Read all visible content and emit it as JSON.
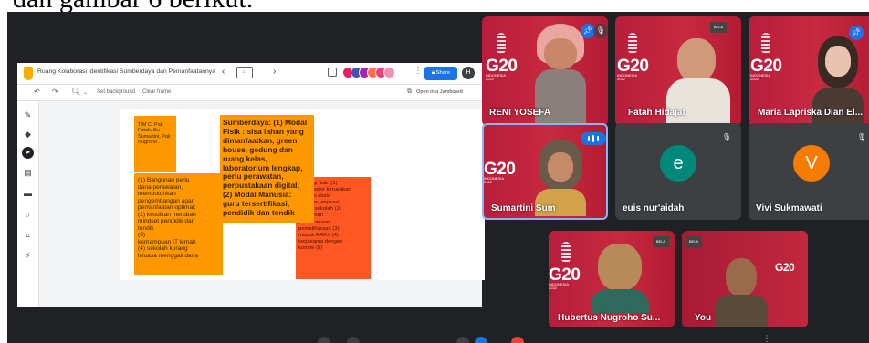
{
  "page_text": "dan gambar 6 berikut.",
  "jamboard": {
    "title": "Ruang Kolaborasi Identifikasi Sumberdaya dan Pemanfaatannya",
    "prev_icon": "chevron-left-icon",
    "next_icon": "chevron-right-icon",
    "share_label": "Share",
    "user_initial": "H",
    "toolbar": {
      "set_background": "Set background",
      "clear_frame": "Clear frame",
      "open_in_jamboard": "Open in a Jamboard"
    },
    "notes": [
      {
        "text": "TIM C: Pak\nFatah, Bu\nSumartini, Pak\nNugroho .",
        "color": "#ff9800"
      },
      {
        "text": "Sumberdaya: (1) Modal\nFisik : sisa lahan yang\ndimanfaatkan, green\nhouse, gedung dan\nruang kelas,\nlaboratorium lengkap,\nperlu perawatan,\nperpustakaan digital;\n(2) Modal Manusia:\nguru tersertifikasi,\npendidik dan tendik",
        "color": "#ff9800"
      },
      {
        "text": "(1) Bangunan perlu\ndana perawatan,\nmembutuhkan\npengembangan agar\npemanfaatan optimal;\n(2) kesulitan merubah\nmindset pendidik dan\ntendik\n(3)\nkemampuan IT lemah\n(4) sekolah kurang\nleluasa menggali dana",
        "color": "#ff9800"
      },
      {
        "text": "Strategi fisik: (1)\nInventarisir kerusakan\ndengan skala\nprioritas, aspirasi\nwarga sekolah (2)\nmenyusun\nperencanaan\npemeliharaan (3)\nmasuk RAKS (4)\nkerjasama dengan\nkomite (5)",
        "color": "#ff5722"
      }
    ]
  },
  "participants": [
    {
      "name": "RENI YOSEFA",
      "g20": "G20",
      "g20_sub": "INDONESIA\n2022"
    },
    {
      "name": "Fatah Hidajat",
      "g20": "G20",
      "g20_sub": "INDONESIA\n2022"
    },
    {
      "name": "Maria Lapriska Dian El...",
      "g20": "G20",
      "g20_sub": "INDONESIA\n2022"
    },
    {
      "name": "Sumartini Sum",
      "g20": "G20",
      "g20_sub": "INDONESIA\n2022"
    },
    {
      "name": "euis nur'aidah",
      "initial": "e",
      "avatar_color": "#00897b"
    },
    {
      "name": "Vivi Sukmawati",
      "initial": "V",
      "avatar_color": "#f57c00"
    },
    {
      "name": "Hubertus Nugroho Su...",
      "g20": "G20",
      "g20_sub": "INDONESIA\n2022"
    },
    {
      "name": "You",
      "g20": "G20",
      "g20_sub": ""
    }
  ],
  "badge_text": "BELA",
  "mic_off_icon": "mic-off-icon",
  "colors": {
    "meet_bg": "#202124",
    "tile_red": "#c0213d",
    "tile_dark": "#3c4043",
    "accent_blue": "#1a73e8"
  }
}
